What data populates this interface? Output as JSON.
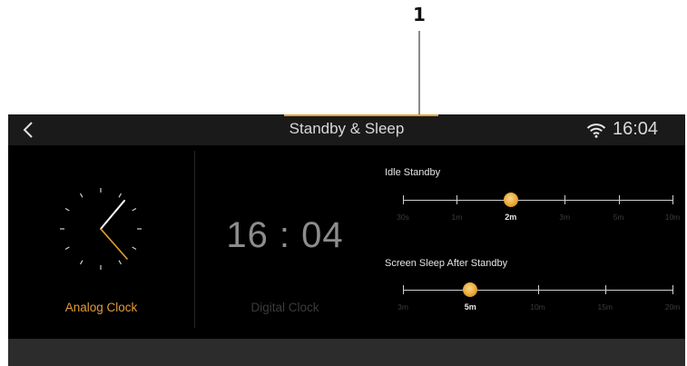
{
  "annotation": {
    "callout_number": "1"
  },
  "header": {
    "title": "Standby & Sleep",
    "time": "16:04",
    "back_icon": "chevron-left-icon",
    "status_icon": "wifi-icon"
  },
  "clock_options": {
    "analog": {
      "label": "Analog Clock",
      "selected": true,
      "icon": "analog-clock-face"
    },
    "digital": {
      "label": "Digital Clock",
      "selected": false,
      "time_display": "16 : 04"
    }
  },
  "settings": {
    "idle_standby": {
      "label": "Idle Standby",
      "options": [
        "30s",
        "1m",
        "2m",
        "3m",
        "5m",
        "10m"
      ],
      "selected_index": 2
    },
    "screen_sleep": {
      "label": "Screen Sleep After Standby",
      "options": [
        "3m",
        "5m",
        "10m",
        "15m",
        "20m"
      ],
      "selected_index": 1
    }
  },
  "colors": {
    "accent": "#e7a033",
    "background": "#000000",
    "topbar": "#1a1a1a",
    "bottom_bar": "#2c2c2c",
    "text_primary": "#d8d8d8"
  }
}
